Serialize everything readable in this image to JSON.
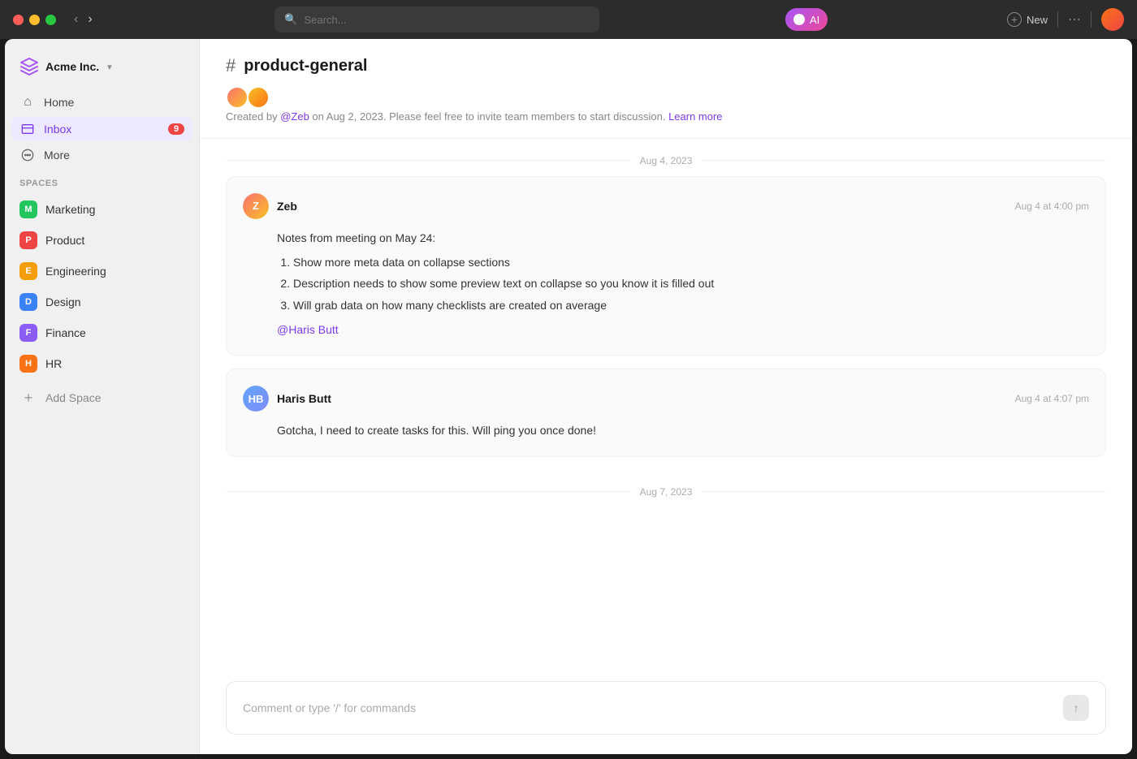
{
  "titlebar": {
    "search_placeholder": "Search...",
    "ai_label": "AI",
    "new_label": "New"
  },
  "sidebar": {
    "workspace_name": "Acme Inc.",
    "nav_items": [
      {
        "id": "home",
        "label": "Home",
        "icon": "⌂",
        "active": false
      },
      {
        "id": "inbox",
        "label": "Inbox",
        "icon": "✉",
        "active": true,
        "badge": "9"
      },
      {
        "id": "more",
        "label": "More",
        "icon": "◯",
        "active": false
      }
    ],
    "spaces_label": "Spaces",
    "spaces": [
      {
        "id": "marketing",
        "label": "Marketing",
        "letter": "M",
        "color": "#22c55e"
      },
      {
        "id": "product",
        "label": "Product",
        "letter": "P",
        "color": "#ef4444"
      },
      {
        "id": "engineering",
        "label": "Engineering",
        "letter": "E",
        "color": "#f59e0b"
      },
      {
        "id": "design",
        "label": "Design",
        "letter": "D",
        "color": "#3b82f6"
      },
      {
        "id": "finance",
        "label": "Finance",
        "letter": "F",
        "color": "#8b5cf6"
      },
      {
        "id": "hr",
        "label": "HR",
        "letter": "H",
        "color": "#f97316"
      }
    ],
    "add_space_label": "Add Space"
  },
  "channel": {
    "name": "product-general",
    "description_prefix": "Created by ",
    "description_mention": "@Zeb",
    "description_middle": " on Aug 2, 2023. Please feel free to invite team members to start discussion. ",
    "description_link": "Learn more"
  },
  "messages": {
    "date_groups": [
      {
        "date": "Aug 4, 2023",
        "messages": [
          {
            "id": "msg1",
            "author": "Zeb",
            "time": "Aug 4 at 4:00 pm",
            "avatar_initials": "Z",
            "notes_intro": "Notes from meeting on May 24:",
            "items": [
              "Show more meta data on collapse sections",
              "Description needs to show some preview text on collapse so you know it is filled out",
              "Will grab data on how many checklists are created on average"
            ],
            "mention": "@Haris Butt"
          },
          {
            "id": "msg2",
            "author": "Haris Butt",
            "time": "Aug 4 at 4:07 pm",
            "avatar_initials": "HB",
            "text": "Gotcha, I need to create tasks for this. Will ping you once done!"
          }
        ]
      },
      {
        "date": "Aug 7, 2023",
        "messages": []
      }
    ]
  },
  "comment_box": {
    "placeholder": "Comment or type '/' for commands"
  }
}
